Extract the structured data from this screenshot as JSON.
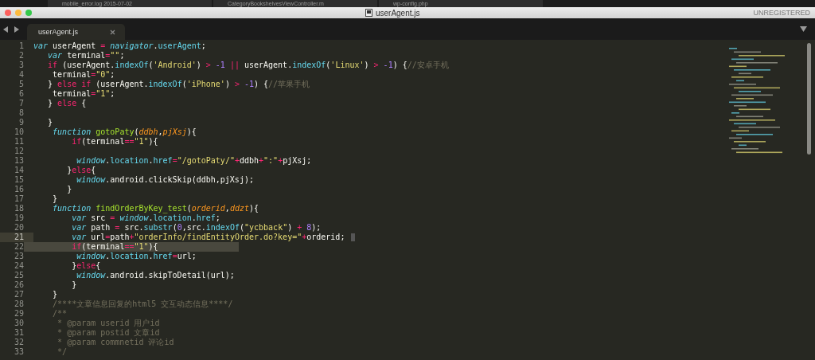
{
  "background_tabs": [
    {
      "label": "mobile_error.log 2015-07-02"
    },
    {
      "label": "CategoryBookshelvesViewController.m"
    },
    {
      "label": "wp-config.php"
    }
  ],
  "window": {
    "title": "userAgent.js",
    "license": "UNREGISTERED"
  },
  "tabs": [
    {
      "label": "userAgent.js",
      "selected": true
    }
  ],
  "lines": [
    {
      "number": "1",
      "current": false,
      "selected": false,
      "tokens": [
        {
          "kind": "st",
          "text": "var"
        },
        {
          "kind": "p",
          "text": " userAgent "
        },
        {
          "kind": "op",
          "text": "= "
        },
        {
          "kind": "bi",
          "text": "navigator"
        },
        {
          "kind": "p",
          "text": "."
        },
        {
          "kind": "sp",
          "text": "userAgent"
        },
        {
          "kind": "p",
          "text": ";"
        }
      ]
    },
    {
      "number": "2",
      "current": false,
      "selected": false,
      "tokens": [
        {
          "kind": "st",
          "text": "   var"
        },
        {
          "kind": "p",
          "text": " terminal"
        },
        {
          "kind": "op",
          "text": "="
        },
        {
          "kind": "s",
          "text": "\"\""
        },
        {
          "kind": "p",
          "text": ";"
        }
      ]
    },
    {
      "number": "3",
      "current": false,
      "selected": false,
      "tokens": [
        {
          "kind": "kw",
          "text": "   if"
        },
        {
          "kind": "p",
          "text": " (userAgent."
        },
        {
          "kind": "sp",
          "text": "indexOf"
        },
        {
          "kind": "p",
          "text": "("
        },
        {
          "kind": "s",
          "text": "'Android'"
        },
        {
          "kind": "p",
          "text": ") "
        },
        {
          "kind": "op",
          "text": "> "
        },
        {
          "kind": "n",
          "text": "-1 "
        },
        {
          "kind": "op",
          "text": "||"
        },
        {
          "kind": "p",
          "text": " userAgent."
        },
        {
          "kind": "sp",
          "text": "indexOf"
        },
        {
          "kind": "p",
          "text": "("
        },
        {
          "kind": "s",
          "text": "'Linux'"
        },
        {
          "kind": "p",
          "text": ") "
        },
        {
          "kind": "op",
          "text": "> "
        },
        {
          "kind": "n",
          "text": "-1"
        },
        {
          "kind": "p",
          "text": ") {"
        },
        {
          "kind": "c",
          "text": "//安卓手机"
        }
      ]
    },
    {
      "number": "4",
      "current": false,
      "selected": false,
      "tokens": [
        {
          "kind": "p",
          "text": "    terminal"
        },
        {
          "kind": "op",
          "text": "="
        },
        {
          "kind": "s",
          "text": "\"0\""
        },
        {
          "kind": "p",
          "text": ";"
        }
      ]
    },
    {
      "number": "5",
      "current": false,
      "selected": false,
      "tokens": [
        {
          "kind": "p",
          "text": "   } "
        },
        {
          "kind": "kw",
          "text": "else if"
        },
        {
          "kind": "p",
          "text": " (userAgent."
        },
        {
          "kind": "sp",
          "text": "indexOf"
        },
        {
          "kind": "p",
          "text": "("
        },
        {
          "kind": "s",
          "text": "'iPhone'"
        },
        {
          "kind": "p",
          "text": ") "
        },
        {
          "kind": "op",
          "text": "> "
        },
        {
          "kind": "n",
          "text": "-1"
        },
        {
          "kind": "p",
          "text": ") {"
        },
        {
          "kind": "c",
          "text": "//苹果手机"
        }
      ]
    },
    {
      "number": "6",
      "current": false,
      "selected": false,
      "tokens": [
        {
          "kind": "p",
          "text": "    terminal"
        },
        {
          "kind": "op",
          "text": "="
        },
        {
          "kind": "s",
          "text": "\"1\""
        },
        {
          "kind": "p",
          "text": ";"
        }
      ]
    },
    {
      "number": "7",
      "current": false,
      "selected": false,
      "tokens": [
        {
          "kind": "p",
          "text": "   } "
        },
        {
          "kind": "kw",
          "text": "else"
        },
        {
          "kind": "p",
          "text": " {"
        }
      ]
    },
    {
      "number": "8",
      "current": false,
      "selected": false
    },
    {
      "number": "9",
      "current": false,
      "selected": false,
      "tokens": [
        {
          "kind": "p",
          "text": "   }"
        }
      ]
    },
    {
      "number": "10",
      "current": false,
      "selected": false,
      "tokens": [
        {
          "kind": "st",
          "text": "    function "
        },
        {
          "kind": "fn",
          "text": "gotoPaty"
        },
        {
          "kind": "p",
          "text": "("
        },
        {
          "kind": "pa",
          "text": "ddbh"
        },
        {
          "kind": "p",
          "text": ","
        },
        {
          "kind": "pa",
          "text": "pjXsj"
        },
        {
          "kind": "p",
          "text": "){"
        }
      ]
    },
    {
      "number": "11",
      "current": false,
      "selected": false,
      "tokens": [
        {
          "kind": "kw",
          "text": "        if"
        },
        {
          "kind": "p",
          "text": "(terminal"
        },
        {
          "kind": "op",
          "text": "=="
        },
        {
          "kind": "s",
          "text": "\"1\""
        },
        {
          "kind": "p",
          "text": "){"
        }
      ]
    },
    {
      "number": "12",
      "current": false,
      "selected": false
    },
    {
      "number": "13",
      "current": false,
      "selected": false,
      "tokens": [
        {
          "kind": "bi",
          "text": "         window"
        },
        {
          "kind": "p",
          "text": "."
        },
        {
          "kind": "sp",
          "text": "location"
        },
        {
          "kind": "p",
          "text": "."
        },
        {
          "kind": "sp",
          "text": "href"
        },
        {
          "kind": "op",
          "text": "="
        },
        {
          "kind": "s",
          "text": "\"/gotoPaty/\""
        },
        {
          "kind": "op",
          "text": "+"
        },
        {
          "kind": "p",
          "text": "ddbh"
        },
        {
          "kind": "op",
          "text": "+"
        },
        {
          "kind": "s",
          "text": "\":\""
        },
        {
          "kind": "op",
          "text": "+"
        },
        {
          "kind": "p",
          "text": "pjXsj;"
        }
      ]
    },
    {
      "number": "14",
      "current": false,
      "selected": false,
      "tokens": [
        {
          "kind": "p",
          "text": "       }"
        },
        {
          "kind": "kw",
          "text": "else"
        },
        {
          "kind": "p",
          "text": "{"
        }
      ]
    },
    {
      "number": "15",
      "current": false,
      "selected": false,
      "tokens": [
        {
          "kind": "bi",
          "text": "         window"
        },
        {
          "kind": "p",
          "text": ".android.clickSkip(ddbh,pjXsj);"
        }
      ]
    },
    {
      "number": "16",
      "current": false,
      "selected": false,
      "tokens": [
        {
          "kind": "p",
          "text": "       }"
        }
      ]
    },
    {
      "number": "17",
      "current": false,
      "selected": false,
      "tokens": [
        {
          "kind": "p",
          "text": "    }"
        }
      ]
    },
    {
      "number": "18",
      "current": false,
      "selected": false,
      "tokens": [
        {
          "kind": "st",
          "text": "    function "
        },
        {
          "kind": "fn",
          "text": "findOrderByKey_test"
        },
        {
          "kind": "p",
          "text": "("
        },
        {
          "kind": "pa",
          "text": "orderid"
        },
        {
          "kind": "p",
          "text": ","
        },
        {
          "kind": "pa",
          "text": "ddzt"
        },
        {
          "kind": "p",
          "text": "){"
        }
      ]
    },
    {
      "number": "19",
      "current": false,
      "selected": false,
      "tokens": [
        {
          "kind": "st",
          "text": "        var"
        },
        {
          "kind": "p",
          "text": " src "
        },
        {
          "kind": "op",
          "text": "= "
        },
        {
          "kind": "bi",
          "text": "window"
        },
        {
          "kind": "p",
          "text": "."
        },
        {
          "kind": "sp",
          "text": "location"
        },
        {
          "kind": "p",
          "text": "."
        },
        {
          "kind": "sp",
          "text": "href"
        },
        {
          "kind": "p",
          "text": ";"
        }
      ]
    },
    {
      "number": "20",
      "current": false,
      "selected": false,
      "tokens": [
        {
          "kind": "st",
          "text": "        var"
        },
        {
          "kind": "p",
          "text": " path "
        },
        {
          "kind": "op",
          "text": "="
        },
        {
          "kind": "p",
          "text": " src."
        },
        {
          "kind": "sp",
          "text": "substr"
        },
        {
          "kind": "p",
          "text": "("
        },
        {
          "kind": "n",
          "text": "0"
        },
        {
          "kind": "p",
          "text": ",src."
        },
        {
          "kind": "sp",
          "text": "indexOf"
        },
        {
          "kind": "p",
          "text": "("
        },
        {
          "kind": "s",
          "text": "\"ycbback\""
        },
        {
          "kind": "p",
          "text": ") "
        },
        {
          "kind": "op",
          "text": "+ "
        },
        {
          "kind": "n",
          "text": "8"
        },
        {
          "kind": "p",
          "text": ");"
        }
      ]
    },
    {
      "number": "21",
      "current": true,
      "selected": false,
      "tokens": [
        {
          "kind": "st",
          "text": "        var"
        },
        {
          "kind": "p",
          "text": " url"
        },
        {
          "kind": "op",
          "text": "="
        },
        {
          "kind": "p",
          "text": "path"
        },
        {
          "kind": "op",
          "text": "+"
        },
        {
          "kind": "s",
          "text": "\"orderInfo/findEntityOrder.do?key=\""
        },
        {
          "kind": "op",
          "text": "+"
        },
        {
          "kind": "p",
          "text": "orderid;"
        }
      ]
    },
    {
      "number": "22",
      "current": false,
      "selected": true,
      "tokens": [
        {
          "kind": "kw",
          "text": "        if"
        },
        {
          "kind": "p",
          "text": "(terminal"
        },
        {
          "kind": "op",
          "text": "=="
        },
        {
          "kind": "s",
          "text": "\"1\""
        },
        {
          "kind": "p",
          "text": "){"
        }
      ]
    },
    {
      "number": "23",
      "current": false,
      "selected": false,
      "tokens": [
        {
          "kind": "bi",
          "text": "         window"
        },
        {
          "kind": "p",
          "text": "."
        },
        {
          "kind": "sp",
          "text": "location"
        },
        {
          "kind": "p",
          "text": "."
        },
        {
          "kind": "sp",
          "text": "href"
        },
        {
          "kind": "op",
          "text": "="
        },
        {
          "kind": "p",
          "text": "url;"
        }
      ]
    },
    {
      "number": "24",
      "current": false,
      "selected": false,
      "tokens": [
        {
          "kind": "p",
          "text": "        }"
        },
        {
          "kind": "kw",
          "text": "else"
        },
        {
          "kind": "p",
          "text": "{"
        }
      ]
    },
    {
      "number": "25",
      "current": false,
      "selected": false,
      "tokens": [
        {
          "kind": "bi",
          "text": "         window"
        },
        {
          "kind": "p",
          "text": ".android.skipToDetail(url);"
        }
      ]
    },
    {
      "number": "26",
      "current": false,
      "selected": false,
      "tokens": [
        {
          "kind": "p",
          "text": "        }"
        }
      ]
    },
    {
      "number": "27",
      "current": false,
      "selected": false,
      "tokens": [
        {
          "kind": "p",
          "text": "    }"
        }
      ]
    },
    {
      "number": "28",
      "current": false,
      "selected": false,
      "tokens": [
        {
          "kind": "c",
          "text": "    /****文章信息回复的html5 交互动态信息****/"
        }
      ]
    },
    {
      "number": "29",
      "current": false,
      "selected": false,
      "tokens": [
        {
          "kind": "c",
          "text": "    /**"
        }
      ]
    },
    {
      "number": "30",
      "current": false,
      "selected": false,
      "tokens": [
        {
          "kind": "c",
          "text": "     * @param userid 用户id"
        }
      ]
    },
    {
      "number": "31",
      "current": false,
      "selected": false,
      "tokens": [
        {
          "kind": "c",
          "text": "     * @param postid 文章id"
        }
      ]
    },
    {
      "number": "32",
      "current": false,
      "selected": false,
      "tokens": [
        {
          "kind": "c",
          "text": "     * @param commnetid 评论id"
        }
      ]
    },
    {
      "number": "33",
      "current": false,
      "selected": false,
      "tokens": [
        {
          "kind": "c",
          "text": "     */"
        }
      ]
    }
  ]
}
